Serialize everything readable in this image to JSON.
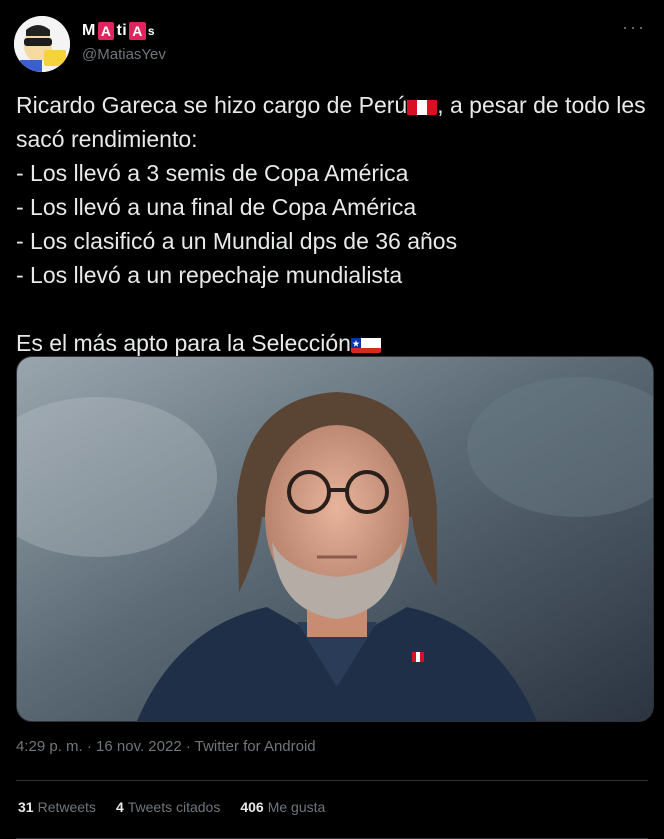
{
  "author": {
    "display_name_parts": [
      "M",
      "A",
      "ti",
      "A",
      "s"
    ],
    "handle": "@MatiasYev",
    "avatar_icon": "cartoon-avatar-icon"
  },
  "menu": {
    "more_label": "···"
  },
  "tweet": {
    "line1_before_flag": "Ricardo Gareca se hizo cargo de Perú",
    "line1_after_flag": ", a pesar de todo les sacó rendimiento:",
    "items": [
      "- Los llevó a 3 semis de Copa América",
      "- Los llevó a una final de Copa América",
      "- Los clasificó a un Mundial dps de 36 años",
      "- Los llevó a un repechaje mundialista"
    ],
    "closing_before_flag": "Es el más apto para la Selección",
    "flag_peru_icon": "peru-flag-icon",
    "flag_chile_icon": "chile-flag-icon"
  },
  "media": {
    "image_icon": "portrait-photo"
  },
  "meta": {
    "time": "4:29 p. m.",
    "separator": "·",
    "date": "16 nov. 2022",
    "source": "Twitter for Android"
  },
  "stats": {
    "retweets_count": "31",
    "retweets_label": "Retweets",
    "quotes_count": "4",
    "quotes_label": "Tweets citados",
    "likes_count": "406",
    "likes_label": "Me gusta"
  },
  "colors": {
    "background": "#000000",
    "text": "#e7e9ea",
    "secondary": "#71767b",
    "divider": "#2f3336",
    "name_box": "#e0245e"
  }
}
